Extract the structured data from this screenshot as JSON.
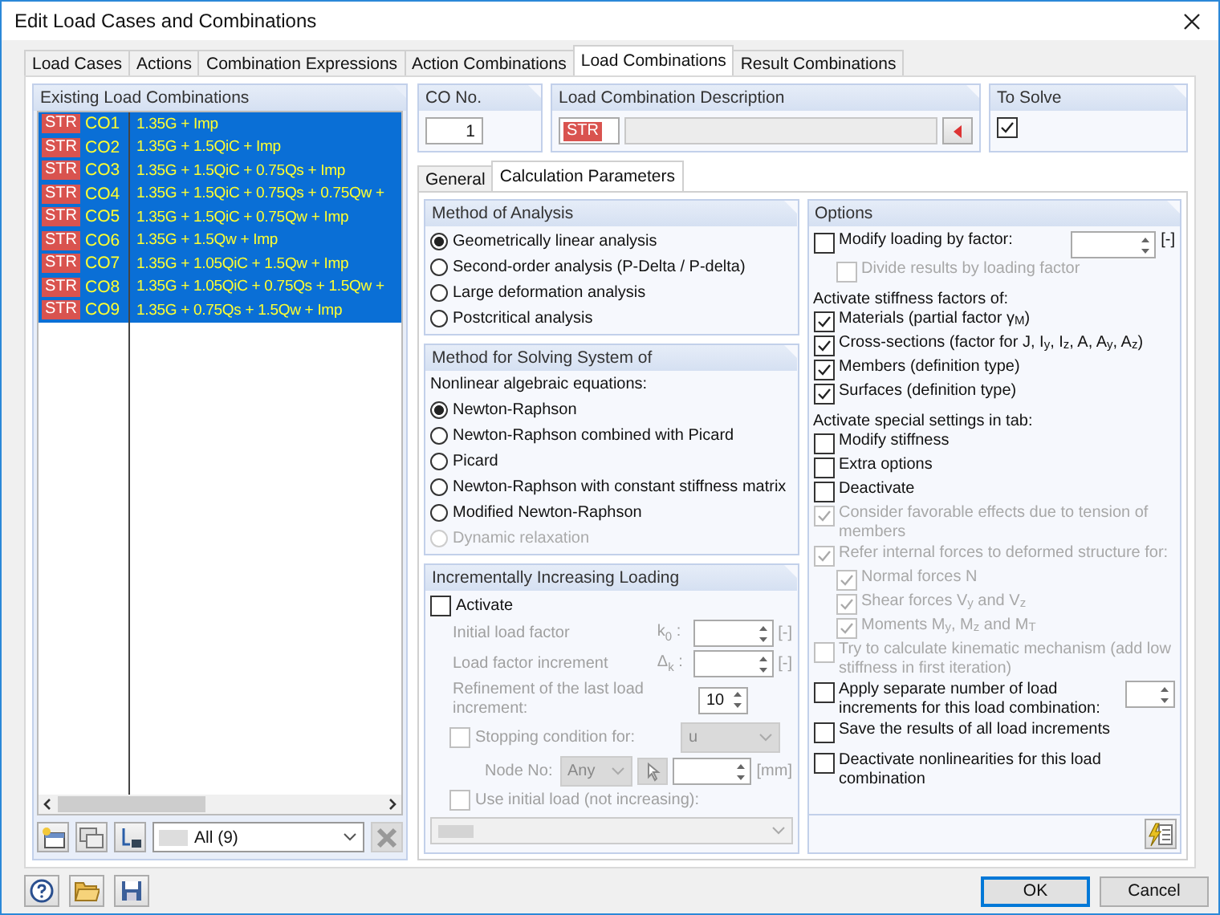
{
  "window": {
    "title": "Edit Load Cases and Combinations"
  },
  "tabs": [
    {
      "label": "Load Cases",
      "selected": false
    },
    {
      "label": "Actions",
      "selected": false
    },
    {
      "label": "Combination Expressions",
      "selected": false
    },
    {
      "label": "Action Combinations",
      "selected": false
    },
    {
      "label": "Load Combinations",
      "selected": true
    },
    {
      "label": "Result Combinations",
      "selected": false
    }
  ],
  "existing_combinations": {
    "title": "Existing Load Combinations",
    "filter": "All (9)",
    "rows": [
      {
        "tag": "STR",
        "name": "CO1",
        "formula": "1.35G + Imp",
        "selected": true
      },
      {
        "tag": "STR",
        "name": "CO2",
        "formula": "1.35G + 1.5QiC + Imp",
        "selected": true
      },
      {
        "tag": "STR",
        "name": "CO3",
        "formula": "1.35G + 1.5QiC + 0.75Qs + Imp",
        "selected": true
      },
      {
        "tag": "STR",
        "name": "CO4",
        "formula": "1.35G + 1.5QiC + 0.75Qs + 0.75Qw +",
        "selected": true
      },
      {
        "tag": "STR",
        "name": "CO5",
        "formula": "1.35G + 1.5QiC + 0.75Qw + Imp",
        "selected": true
      },
      {
        "tag": "STR",
        "name": "CO6",
        "formula": "1.35G + 1.5Qw + Imp",
        "selected": true
      },
      {
        "tag": "STR",
        "name": "CO7",
        "formula": "1.35G + 1.05QiC + 1.5Qw + Imp",
        "selected": true
      },
      {
        "tag": "STR",
        "name": "CO8",
        "formula": "1.35G + 1.05QiC + 0.75Qs + 1.5Qw +",
        "selected": true
      },
      {
        "tag": "STR",
        "name": "CO9",
        "formula": "1.35G + 0.75Qs + 1.5Qw + Imp",
        "selected": true
      }
    ]
  },
  "co_no": {
    "label": "CO No.",
    "value": "1"
  },
  "description": {
    "label": "Load Combination Description",
    "tag": "STR"
  },
  "to_solve": {
    "label": "To Solve",
    "checked": true
  },
  "subtabs": [
    {
      "label": "General",
      "selected": false
    },
    {
      "label": "Calculation Parameters",
      "selected": true
    }
  ],
  "method_of_analysis": {
    "title": "Method of Analysis",
    "options": [
      {
        "label": "Geometrically linear analysis",
        "selected": true
      },
      {
        "label": "Second-order analysis (P-Delta / P-delta)",
        "selected": false
      },
      {
        "label": "Large deformation analysis",
        "selected": false
      },
      {
        "label": "Postcritical analysis",
        "selected": false
      }
    ]
  },
  "method_for_solving": {
    "title": "Method for Solving System of",
    "subtitle": "Nonlinear algebraic equations:",
    "options": [
      {
        "label": "Newton-Raphson",
        "selected": true,
        "disabled": false
      },
      {
        "label": "Newton-Raphson combined with Picard",
        "selected": false,
        "disabled": false
      },
      {
        "label": "Picard",
        "selected": false,
        "disabled": false
      },
      {
        "label": "Newton-Raphson with constant stiffness matrix",
        "selected": false,
        "disabled": false
      },
      {
        "label": "Modified Newton-Raphson",
        "selected": false,
        "disabled": false
      },
      {
        "label": "Dynamic relaxation",
        "selected": false,
        "disabled": true
      }
    ]
  },
  "incremental_loading": {
    "title": "Incrementally Increasing Loading",
    "activate": {
      "label": "Activate",
      "checked": false
    },
    "fields": [
      {
        "label": "Initial load factor",
        "symbol": "k$_{0}$ :",
        "unit": "[-]"
      },
      {
        "label": "Load factor increment",
        "symbol": "Δ$_{k}$ :",
        "unit": "[-]"
      }
    ],
    "refinement": {
      "label": "Refinement of the last load increment:",
      "value": "10"
    },
    "stopping": {
      "label": "Stopping condition for:",
      "checked": false,
      "select": "u",
      "node_label": "Node No:",
      "node_select": "Any",
      "unit": "[mm]"
    },
    "initial_load": {
      "label": "Use initial load (not increasing):",
      "checked": false
    }
  },
  "options": {
    "title": "Options",
    "items": [
      {
        "kind": "check_field",
        "label": "Modify loading by factor:",
        "checked": false,
        "disabled": false,
        "unit": "[-]",
        "children": [
          {
            "label": "Divide results by loading factor",
            "checked": false,
            "disabled": true
          }
        ]
      },
      {
        "kind": "heading",
        "label": "Activate stiffness factors of:"
      },
      {
        "kind": "check",
        "label": "Materials (partial factor γ$_{M}$)",
        "checked": true,
        "disabled": false
      },
      {
        "kind": "check",
        "label": "Cross-sections (factor for J, I$_{y}$, I$_{z}$, A, A$_{y}$, A$_{z}$)",
        "checked": true,
        "disabled": false
      },
      {
        "kind": "check",
        "label": "Members (definition type)",
        "checked": true,
        "disabled": false
      },
      {
        "kind": "check",
        "label": "Surfaces (definition type)",
        "checked": true,
        "disabled": false
      },
      {
        "kind": "heading",
        "label": "Activate special settings in tab:"
      },
      {
        "kind": "check",
        "label": "Modify stiffness",
        "checked": false,
        "disabled": false
      },
      {
        "kind": "check",
        "label": "Extra options",
        "checked": false,
        "disabled": false
      },
      {
        "kind": "check",
        "label": "Deactivate",
        "checked": false,
        "disabled": false
      },
      {
        "kind": "check",
        "label": "Consider favorable effects due to tension of members",
        "checked": true,
        "disabled": true
      },
      {
        "kind": "check",
        "label": "Refer internal forces to deformed structure for:",
        "checked": true,
        "disabled": true,
        "children": [
          {
            "label": "Normal forces N",
            "checked": true,
            "disabled": true
          },
          {
            "label": "Shear forces V$_{y}$ and V$_{z}$",
            "checked": true,
            "disabled": true
          },
          {
            "label": "Moments M$_{y}$, M$_{z}$ and M$_{T}$",
            "checked": true,
            "disabled": true
          }
        ]
      },
      {
        "kind": "check",
        "label": "Try to calculate kinematic mechanism (add low stiffness in first iteration)",
        "checked": false,
        "disabled": true
      },
      {
        "kind": "check_field",
        "label": "Apply separate number of load increments for this load combination:",
        "checked": false,
        "disabled": false
      },
      {
        "kind": "check",
        "label": "Save the results of all load increments",
        "checked": false,
        "disabled": false
      },
      {
        "kind": "check",
        "label": "Deactivate nonlinearities for this load combination",
        "checked": false,
        "disabled": false
      }
    ]
  },
  "buttons": [
    {
      "label": "OK",
      "default": true
    },
    {
      "label": "Cancel",
      "default": false
    }
  ]
}
